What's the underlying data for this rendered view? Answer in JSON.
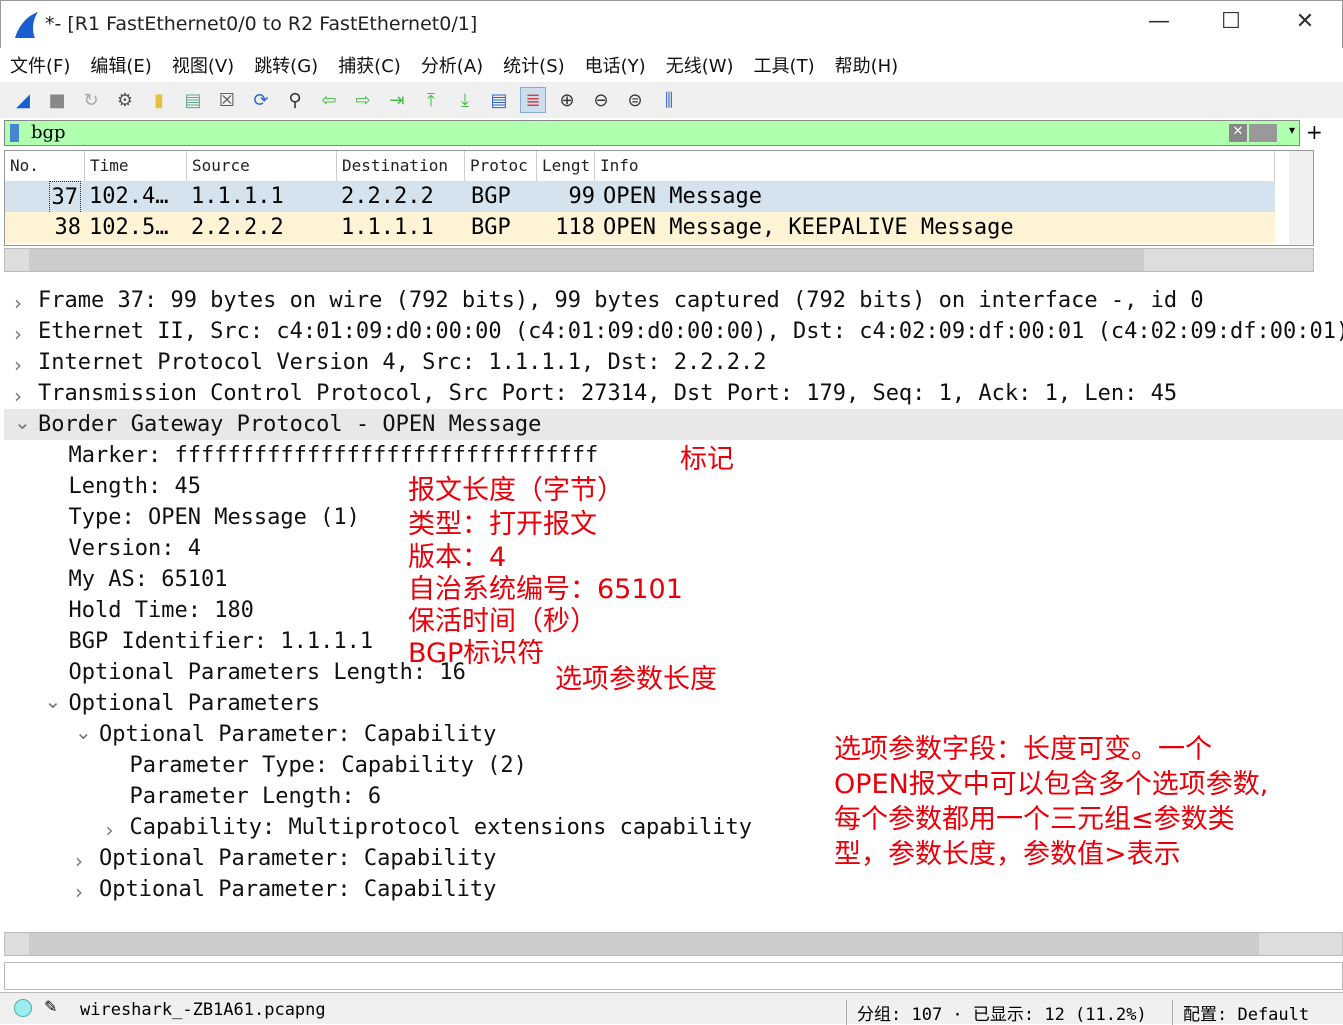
{
  "window": {
    "title": "*- [R1 FastEthernet0/0 to R2 FastEthernet0/1]",
    "minimize": "—",
    "maximize": "☐",
    "close": "✕"
  },
  "menu": [
    "文件(F)",
    "编辑(E)",
    "视图(V)",
    "跳转(G)",
    "捕获(C)",
    "分析(A)",
    "统计(S)",
    "电话(Y)",
    "无线(W)",
    "工具(T)",
    "帮助(H)"
  ],
  "toolbar_icons": [
    "shark-fin-start-icon",
    "stop-icon",
    "restart-icon",
    "options-gear-icon",
    "open-folder-icon",
    "file-icon",
    "close-file-icon",
    "reload-icon",
    "find-icon",
    "back-arrow-icon",
    "forward-arrow-icon",
    "goto-packet-icon",
    "first-packet-icon",
    "last-packet-icon",
    "autoscroll-icon",
    "colorize-icon",
    "zoom-in-icon",
    "zoom-out-icon",
    "zoom-normal-icon",
    "resize-columns-icon"
  ],
  "filter": {
    "value": "bgp"
  },
  "packet_list": {
    "columns": [
      "No.",
      "Time",
      "Source",
      "Destination",
      "Protoc",
      "Lengt",
      "Info"
    ],
    "rows": [
      {
        "no": "37",
        "time": "102.4…",
        "src": "1.1.1.1",
        "dst": "2.2.2.2",
        "proto": "BGP",
        "len": "99",
        "info": "OPEN Message"
      },
      {
        "no": "38",
        "time": "102.5…",
        "src": "2.2.2.2",
        "dst": "1.1.1.1",
        "proto": "BGP",
        "len": "118",
        "info": "OPEN Message, KEEPALIVE Message"
      }
    ]
  },
  "details": [
    {
      "text": "Frame 37: 99 bytes on wire (792 bits), 99 bytes captured (792 bits) on interface -, id 0",
      "arrow": ">"
    },
    {
      "text": "Ethernet II, Src: c4:01:09:d0:00:00 (c4:01:09:d0:00:00), Dst: c4:02:09:df:00:01 (c4:02:09:df:00:01)",
      "arrow": ">"
    },
    {
      "text": "Internet Protocol Version 4, Src: 1.1.1.1, Dst: 2.2.2.2",
      "arrow": ">"
    },
    {
      "text": "Transmission Control Protocol, Src Port: 27314, Dst Port: 179, Seq: 1, Ack: 1, Len: 45",
      "arrow": ">"
    },
    {
      "text": "Border Gateway Protocol - OPEN Message",
      "arrow": "v"
    },
    {
      "text": "Marker: ffffffffffffffffffffffffffffffff",
      "arrow": ""
    },
    {
      "text": "Length: 45",
      "arrow": ""
    },
    {
      "text": "Type: OPEN Message (1)",
      "arrow": ""
    },
    {
      "text": "Version: 4",
      "arrow": ""
    },
    {
      "text": "My AS: 65101",
      "arrow": ""
    },
    {
      "text": "Hold Time: 180",
      "arrow": ""
    },
    {
      "text": "BGP Identifier: 1.1.1.1",
      "arrow": ""
    },
    {
      "text": "Optional Parameters Length: 16",
      "arrow": ""
    },
    {
      "text": "Optional Parameters",
      "arrow": "v"
    },
    {
      "text": "Optional Parameter: Capability",
      "arrow": "v"
    },
    {
      "text": "Parameter Type: Capability (2)",
      "arrow": ""
    },
    {
      "text": "Parameter Length: 6",
      "arrow": ""
    },
    {
      "text": "Capability: Multiprotocol extensions capability",
      "arrow": ">"
    },
    {
      "text": "Optional Parameter: Capability",
      "arrow": ">"
    },
    {
      "text": "Optional Parameter: Capability",
      "arrow": ">"
    }
  ],
  "annotations": {
    "marker": "标记",
    "length": "报文长度（字节）",
    "type": "类型：打开报文",
    "version": "版本：4",
    "myas": "自治系统编号：65101",
    "hold": "保活时间（秒）",
    "bgpid": "BGP标识符",
    "optlen": "选项参数长度",
    "opt1": "选项参数字段：长度可变。一个",
    "opt2": "OPEN报文中可以包含多个选项参数,",
    "opt3": "每个参数都用一个三元组≤参数类",
    "opt4": "型，参数长度，参数值>表示"
  },
  "status": {
    "file": "wireshark_-ZB1A61.pcapng",
    "packets": "分组: 107 · 已显示: 12 (11.2%)",
    "profile": "配置: Default"
  },
  "colors": {
    "filter_bg": "#afffaf",
    "row_bg": "#fff3d6",
    "selected_row": "#d5e3ee",
    "annotation": "#e8000a"
  }
}
